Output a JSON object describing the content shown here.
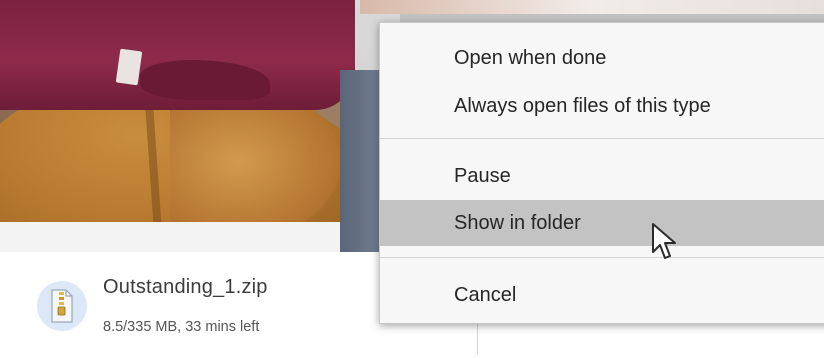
{
  "download": {
    "file_name": "Outstanding_1.zip",
    "status": "8.5/335 MB, 33 mins left",
    "icon": "zip-file-icon"
  },
  "context_menu": {
    "items": [
      {
        "label": "Open when done"
      },
      {
        "label": "Always open files of this type"
      },
      {
        "label": "Pause"
      },
      {
        "label": "Show in folder",
        "highlighted": true
      },
      {
        "label": "Cancel"
      }
    ]
  },
  "colors": {
    "menu_background": "#f7f7f7",
    "menu_highlight": "#c3c3c3",
    "icon_background": "#dce8f7"
  },
  "cursor": "arrow-pointer-icon"
}
